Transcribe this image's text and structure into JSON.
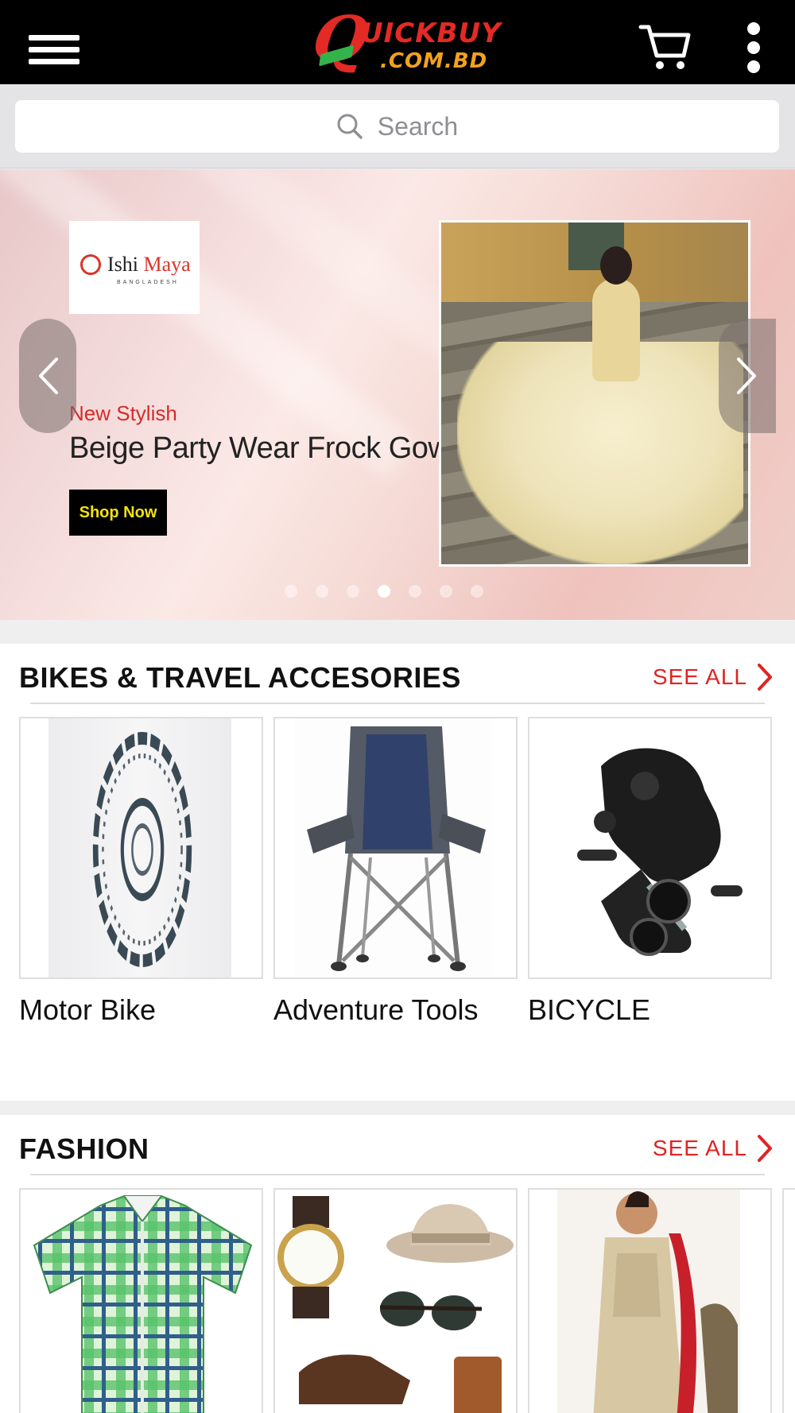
{
  "header": {
    "logo_main": "UICKBUY",
    "logo_letter": "Q",
    "logo_sub": ".COM.BD",
    "menu_icon": "hamburger-icon",
    "cart_icon": "cart-icon",
    "more_icon": "more-vertical-icon"
  },
  "search": {
    "placeholder": "Search",
    "icon": "search-icon"
  },
  "banner": {
    "brand_name_part1": "Ishi ",
    "brand_name_part2": "Maya",
    "brand_sub": "BANGLADESH",
    "kicker": "New Stylish",
    "title": "Beige Party Wear Frock Gown",
    "cta": "Shop Now",
    "slide_count": 7,
    "active_slide": 4
  },
  "sections": [
    {
      "title": "BIKES & TRAVEL ACCESORIES",
      "see_all": "SEE ALL",
      "items": [
        {
          "label": "Motor Bike",
          "image": "brake-disc"
        },
        {
          "label": "Adventure Tools",
          "image": "camping-chair"
        },
        {
          "label": "BICYCLE",
          "image": "rear-derailleur"
        }
      ]
    },
    {
      "title": "FASHION",
      "see_all": "SEE ALL",
      "items": [
        {
          "label": "",
          "image": "checked-shirt"
        },
        {
          "label": "",
          "image": "watch-hat-sunglasses-shoes"
        },
        {
          "label": "",
          "image": "salwar-kameez"
        }
      ]
    }
  ],
  "colors": {
    "header_bg": "#000000",
    "accent_red": "#e02323",
    "logo_orange": "#f2a21d",
    "cta_text": "#f2e30c"
  }
}
